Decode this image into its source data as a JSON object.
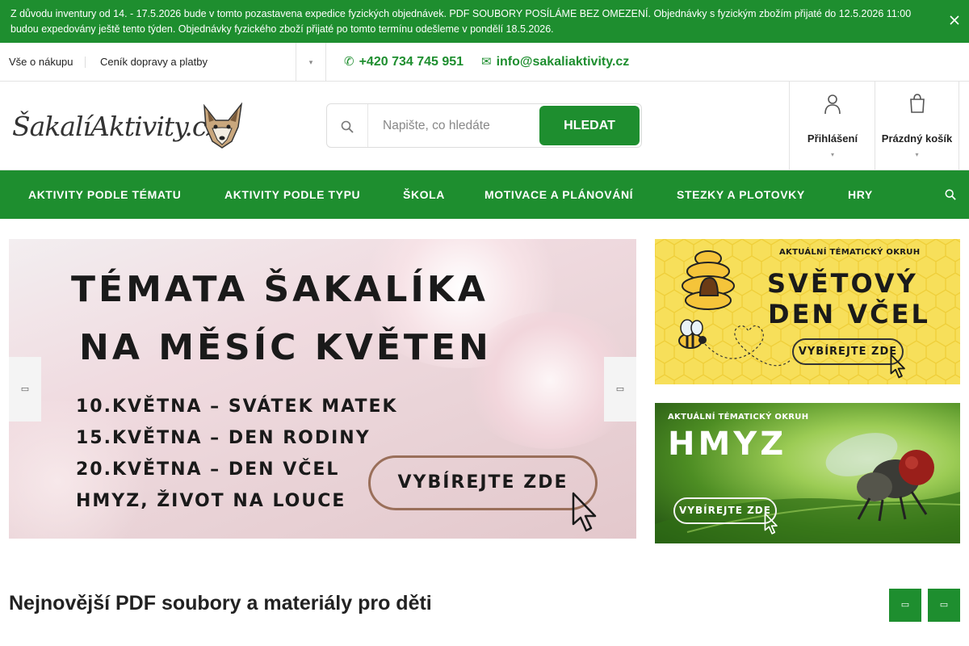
{
  "announcement": {
    "text": "Z důvodu inventury od 14. - 17.5.2026 bude v tomto pozastavena expedice fyzických objednávek. PDF SOUBORY POSÍLÁME BEZ OMEZENÍ. Objednávky s fyzickým zbožím přijaté do 12.5.2026 11:00 budou expedovány ještě tento týden. Objednávky fyzického zboží přijaté po tomto termínu odešleme v pondělí 18.5.2026."
  },
  "topbar": {
    "links": [
      "Vše o nákupu",
      "Ceník dopravy a platby"
    ],
    "phone": "+420 734 745 951",
    "email": "info@sakaliaktivity.cz"
  },
  "header": {
    "logo_text": "ŠakalíAktivity.cz",
    "search_placeholder": "Napište, co hledáte",
    "search_button": "HLEDAT",
    "login_label": "Přihlášení",
    "cart_label": "Prázdný košík"
  },
  "nav": {
    "items": [
      "AKTIVITY PODLE TÉMATU",
      "AKTIVITY PODLE TYPU",
      "ŠKOLA",
      "MOTIVACE A PLÁNOVÁNÍ",
      "STEZKY A PLOTOVKY",
      "HRY"
    ]
  },
  "hero": {
    "title_line1": "TÉMATA ŠAKALÍKA",
    "title_line2": "NA MĚSÍC KVĚTEN",
    "lines": [
      "10.KVĚTNA – SVÁTEK MATEK",
      "15.KVĚTNA – DEN RODINY",
      "20.KVĚTNA – DEN VČEL",
      "HMYZ, ŽIVOT NA LOUCE"
    ],
    "cta": "VYBÍREJTE ZDE"
  },
  "banners": [
    {
      "kicker": "AKTUÁLNÍ TÉMATICKÝ OKRUH",
      "title_line1": "SVĚTOVÝ",
      "title_line2": "DEN VČEL",
      "cta": "VYBÍREJTE ZDE"
    },
    {
      "kicker": "AKTUÁLNÍ TÉMATICKÝ OKRUH",
      "title": "HMYZ",
      "cta": "VYBÍREJTE ZDE"
    }
  ],
  "section": {
    "title": "Nejnovější PDF soubory a materiály pro děti"
  },
  "colors": {
    "brand_green": "#1e8e2f",
    "bee_yellow": "#f7df5a"
  },
  "icons": {
    "phone": "phone-icon",
    "email": "email-icon",
    "search": "search-icon",
    "user": "user-icon",
    "cart": "cart-icon",
    "close": "close-icon"
  }
}
